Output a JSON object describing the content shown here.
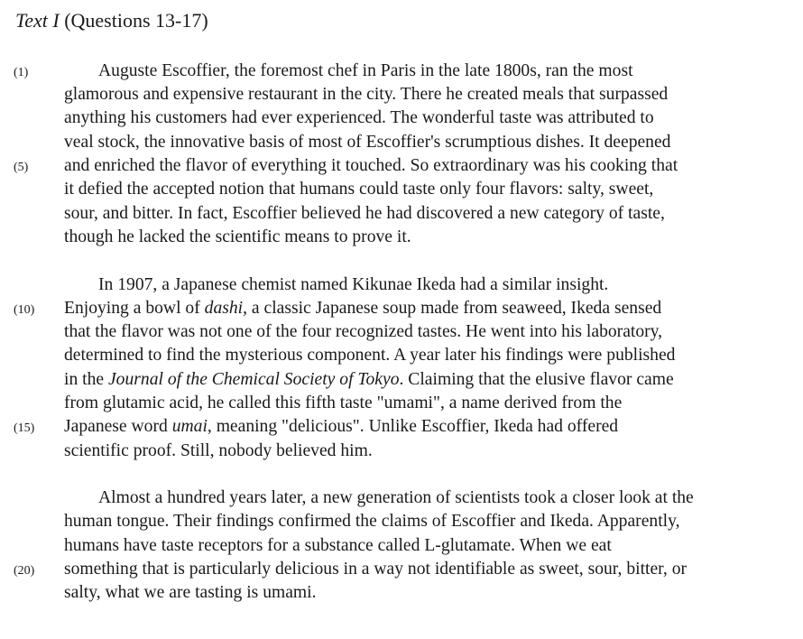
{
  "heading": {
    "title_italic": "Text I",
    "subtitle": "(Questions 13-17)"
  },
  "line_numbers": [
    "(1)",
    "(5)",
    "(10)",
    "(15)",
    "(20)"
  ],
  "p1": [
    "Auguste Escoffier, the foremost chef in Paris in the late 1800s, ran the most",
    "glamorous and expensive restaurant in the city.  There he created meals that surpassed",
    "anything his customers had ever experienced.  The wonderful taste was attributed to",
    "veal stock, the innovative basis of most of Escoffier's scrumptious dishes.  It deepened",
    "and enriched the flavor of everything it touched.  So extraordinary was his cooking that",
    "it defied the accepted notion that humans could taste only four flavors:  salty, sweet,",
    "sour, and bitter.  In fact, Escoffier believed he had discovered a new category of taste,",
    "though he lacked the scientific means to prove it."
  ],
  "p2": {
    "l1": "In 1907, a Japanese chemist named Kikunae Ikeda had a similar insight.",
    "l2a": "Enjoying a bowl of ",
    "l2b": "dashi",
    "l2c": ", a classic Japanese soup made from seaweed, Ikeda sensed",
    "l3": "that the flavor was not one of the four recognized tastes.  He went into his laboratory,",
    "l4": "determined to find the mysterious component.  A year later his findings were published",
    "l5a": "in the ",
    "l5b": "Journal of the Chemical Society of Tokyo",
    "l5c": ".  Claiming that the elusive flavor came",
    "l6": "from glutamic acid, he called this fifth taste \"umami\", a name derived from the",
    "l7a": "Japanese word ",
    "l7b": "umai",
    "l7c": ", meaning \"delicious\".  Unlike Escoffier, Ikeda had offered",
    "l8": "scientific proof.  Still, nobody believed him."
  },
  "p3": [
    "Almost a hundred years later, a new generation of scientists took a closer look at the",
    "human tongue.  Their findings confirmed the claims of Escoffier and Ikeda.  Apparently,",
    "humans have taste receptors for a substance called L-glutamate.  When we eat",
    "something that is particularly delicious in a way not identifiable as sweet, sour, bitter, or",
    "salty, what we are tasting is umami."
  ]
}
